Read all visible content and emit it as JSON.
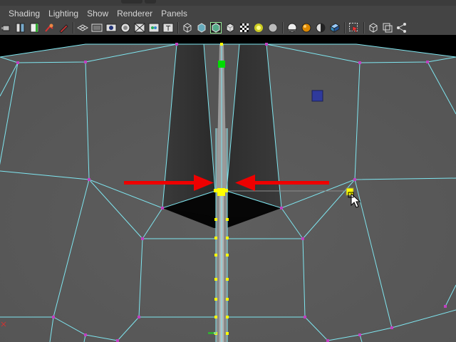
{
  "menu": {
    "items": [
      {
        "id": "shading",
        "label": "Shading"
      },
      {
        "id": "lighting",
        "label": "Lighting"
      },
      {
        "id": "show",
        "label": "Show"
      },
      {
        "id": "renderer",
        "label": "Renderer"
      },
      {
        "id": "panels",
        "label": "Panels"
      }
    ]
  },
  "toolbar": {
    "icons": [
      "select-camera-icon",
      "camera-attributes-icon",
      "bookmark-icon",
      "image-plane-icon",
      "grease-pencil-icon",
      "grid-toggle-icon",
      "film-gate-icon",
      "resolution-gate-icon",
      "gate-mask-icon",
      "field-chart-icon",
      "safe-action-icon",
      "safe-title-icon",
      "wireframe-icon",
      "smooth-shade-icon",
      "wireframe-on-shaded-icon",
      "textured-icon",
      "use-all-lights-icon",
      "shadows-icon",
      "ambient-occlusion-icon",
      "motion-blur-icon",
      "anti-alias-icon",
      "depth-of-field-icon",
      "isolate-select-icon",
      "xray-icon",
      "xray-joints-icon",
      "xray-components-icon"
    ]
  },
  "viewport": {
    "colors": {
      "background": "#000000",
      "mesh_face": "#5a5a5a",
      "mesh_face_dark": "#444444",
      "wire": "#7fe6f0",
      "vertex": "#c040c0",
      "selected_vertex": "#ffff00",
      "pivot": "#00dd00",
      "annotation_arrow": "#ee0000",
      "manipulator": "#2f3a9c"
    },
    "annotation_arrows": [
      "arrow-pointing-right",
      "arrow-pointing-left"
    ]
  }
}
